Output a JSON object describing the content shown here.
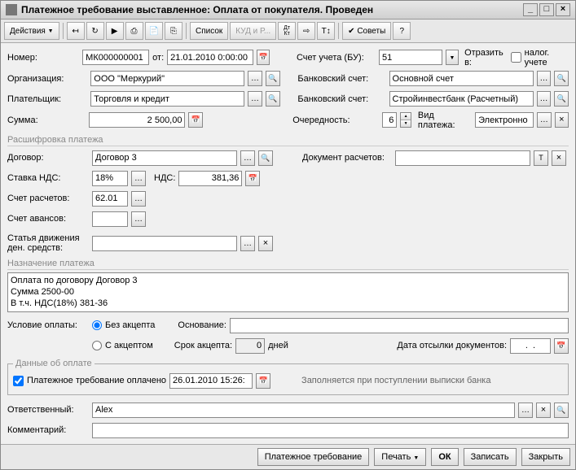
{
  "window": {
    "title": "Платежное требование выставленное: Оплата от покупателя. Проведен"
  },
  "toolbar": {
    "actions": "Действия",
    "list": "Список",
    "kudir": "КУД и Р...",
    "dtkt": "Дт\nКт",
    "tips": "Советы"
  },
  "fields": {
    "number_lbl": "Номер:",
    "number": "МК000000001",
    "from_lbl": "от:",
    "date": "21.01.2010 0:00:00",
    "org_lbl": "Организация:",
    "org": "ООО \"Меркурий\"",
    "payer_lbl": "Плательщик:",
    "payer": "Торговля и кредит",
    "sum_lbl": "Сумма:",
    "sum": "2 500,00",
    "account_bu_lbl": "Счет учета (БУ):",
    "account_bu": "51",
    "reflect_lbl": "Отразить в:",
    "tax_chk_lbl": "налог. учете",
    "bank_acc_lbl": "Банковский счет:",
    "bank_acc1": "Основной счет",
    "bank_acc2": "Стройинвестбанк (Расчетный)",
    "priority_lbl": "Очередность:",
    "priority": "6",
    "pay_kind_lbl": "Вид платежа:",
    "pay_kind": "Электронно"
  },
  "pay_detail": {
    "header": "Расшифровка платежа",
    "contract_lbl": "Договор:",
    "contract": "Договор 3",
    "doc_calc_lbl": "Документ расчетов:",
    "vat_rate_lbl": "Ставка НДС:",
    "vat_rate": "18%",
    "vat_lbl": "НДС:",
    "vat": "381,36",
    "calc_acc_lbl": "Счет расчетов:",
    "calc_acc": "62.01",
    "advance_acc_lbl": "Счет авансов:",
    "cashflow_lbl": "Статья движения\nден. средств:"
  },
  "purpose": {
    "header": "Назначение платежа",
    "text": "Оплата по договору Договор 3\nСумма 2500-00\nВ т.ч. НДС(18%) 381-36"
  },
  "conditions": {
    "cond_lbl": "Условие оплаты:",
    "no_accept": "Без акцепта",
    "with_accept": "С акцептом",
    "basis_lbl": "Основание:",
    "accept_term_lbl": "Срок акцепта:",
    "accept_term": "0",
    "days": "дней",
    "doc_send_date_lbl": "Дата отсылки документов:",
    "doc_send_date": ".  ."
  },
  "payment_data": {
    "legend": "Данные об оплате",
    "paid_lbl": "Платежное требование оплачено",
    "paid_date": "26.01.2010 15:26:",
    "hint": "Заполняется при поступлении выписки банка"
  },
  "bottom": {
    "resp_lbl": "Ответственный:",
    "resp": "Alex",
    "comment_lbl": "Комментарий:"
  },
  "footer": {
    "doc": "Платежное требование",
    "print": "Печать",
    "ok": "ОК",
    "save": "Записать",
    "close": "Закрыть"
  }
}
